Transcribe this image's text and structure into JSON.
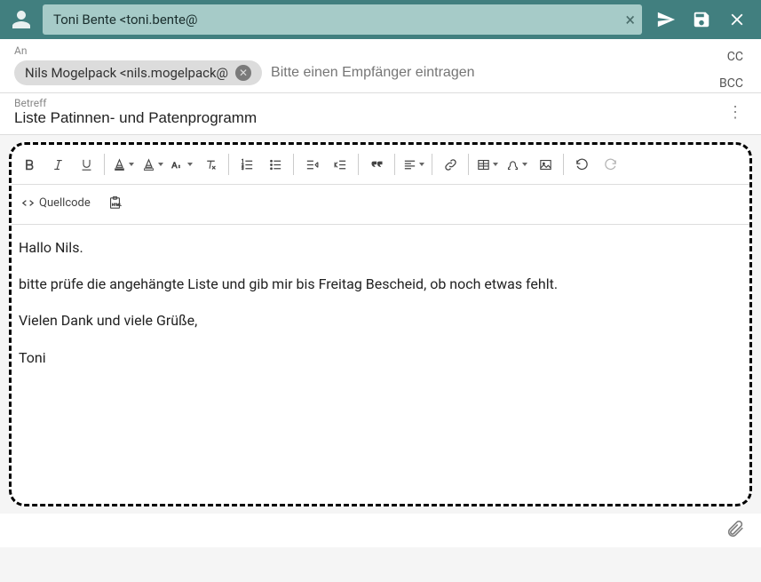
{
  "header": {
    "from": "Toni Bente <toni.bente@",
    "send": "Send",
    "save": "Save",
    "close": "Close"
  },
  "to": {
    "label": "An",
    "chip": "Nils Mogelpack <nils.mogelpack@",
    "placeholder": "Bitte einen Empfänger eintragen",
    "cc": "CC",
    "bcc": "BCC"
  },
  "subject": {
    "label": "Betreff",
    "value": "Liste Patinnen- und Patenprogramm"
  },
  "toolbar": {
    "source_label": "Quellcode"
  },
  "body": {
    "p1": "Hallo Nils.",
    "p2": "bitte prüfe die angehängte Liste und gib mir bis Freitag Bescheid, ob noch etwas fehlt.",
    "p3": "Vielen Dank und viele Grüße,",
    "p4": "Toni"
  }
}
